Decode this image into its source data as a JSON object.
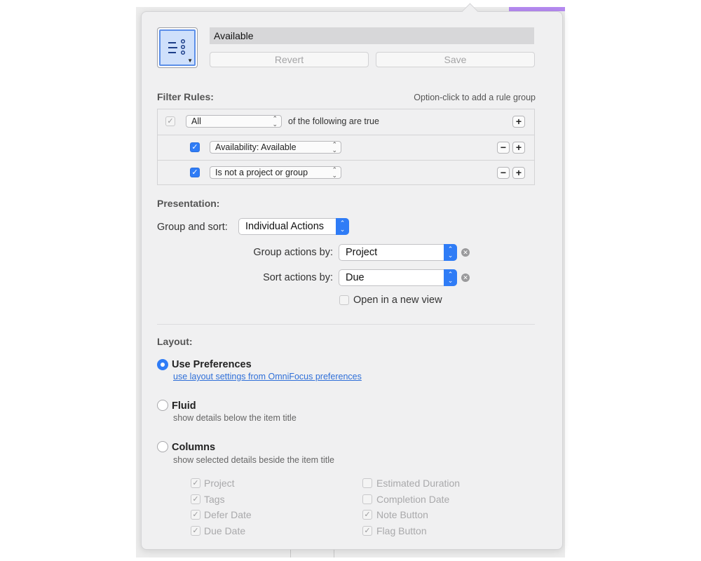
{
  "header": {
    "perspective_name": "Available",
    "revert_label": "Revert",
    "save_label": "Save"
  },
  "filter_rules": {
    "title": "Filter Rules:",
    "hint": "Option-click to add a rule group",
    "root": {
      "match_value": "All",
      "suffix_text": "of the following are true",
      "checked": true
    },
    "rules": [
      {
        "value": "Availability: Available",
        "checked": true
      },
      {
        "value": "Is not a project or group",
        "checked": true
      }
    ],
    "plus_glyph": "+",
    "minus_glyph": "−"
  },
  "presentation": {
    "title": "Presentation:",
    "group_sort_label": "Group and sort:",
    "group_sort_value": "Individual Actions",
    "group_by_label": "Group actions by:",
    "group_by_value": "Project",
    "sort_by_label": "Sort actions by:",
    "sort_by_value": "Due",
    "open_new_view_label": "Open in a new view",
    "open_new_view_checked": false
  },
  "layout": {
    "title": "Layout:",
    "options": [
      {
        "title": "Use Preferences",
        "subtitle": "use layout settings from OmniFocus preferences",
        "selected": true,
        "subtitle_is_link": true
      },
      {
        "title": "Fluid",
        "subtitle": "show details below the item title",
        "selected": false
      },
      {
        "title": "Columns",
        "subtitle": "show selected details beside the item title",
        "selected": false
      }
    ],
    "columns_left": [
      {
        "label": "Project",
        "checked": true
      },
      {
        "label": "Tags",
        "checked": true
      },
      {
        "label": "Defer Date",
        "checked": true
      },
      {
        "label": "Due Date",
        "checked": true
      }
    ],
    "columns_right": [
      {
        "label": "Estimated Duration",
        "checked": false
      },
      {
        "label": "Completion Date",
        "checked": false
      },
      {
        "label": "Note Button",
        "checked": true
      },
      {
        "label": "Flag Button",
        "checked": true
      }
    ]
  },
  "glyphs": {
    "check": "✓",
    "updown": "⌃⌄",
    "clear": "✕"
  },
  "colors": {
    "accent": "#2f7cf6",
    "popover_bg": "#f0f0f1"
  }
}
